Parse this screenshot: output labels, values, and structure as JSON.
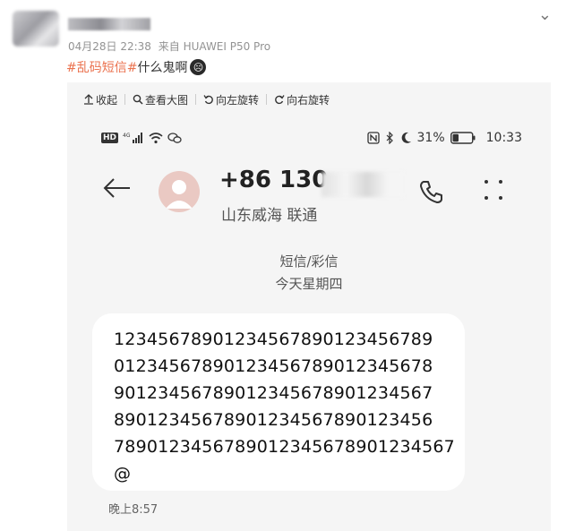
{
  "post": {
    "meta_date": "04月28日 22:38",
    "meta_source": "来自 HUAWEI P50 Pro",
    "caption_hashtag": "#乱码短信#",
    "caption_text": "什么鬼啊",
    "emoji_icon": "crying-face-emoji"
  },
  "toolbar": {
    "collapse_label": "收起",
    "view_large_label": "查看大图",
    "rotate_left_label": "向左旋转",
    "rotate_right_label": "向右旋转"
  },
  "status_bar": {
    "network": "4G",
    "battery_percent": "31%",
    "time": "10:33",
    "battery_level": 0.31
  },
  "contact": {
    "number_visible": "+86 130",
    "location": "山东威海 联通"
  },
  "thread": {
    "message_type": "短信/彩信",
    "date_label": "今天星期四"
  },
  "message": {
    "lines": [
      "12345678901234567890123456789",
      "01234567890123456789012345678",
      "90123456789012345678901234567",
      "89012345678901234567890123456",
      "7890123456789012345678901234567",
      "@"
    ],
    "time": "晚上8:57"
  },
  "colors": {
    "hashtag": "#eb7350",
    "card_bg": "#f5f5f5",
    "bubble_bg": "#ffffff"
  }
}
